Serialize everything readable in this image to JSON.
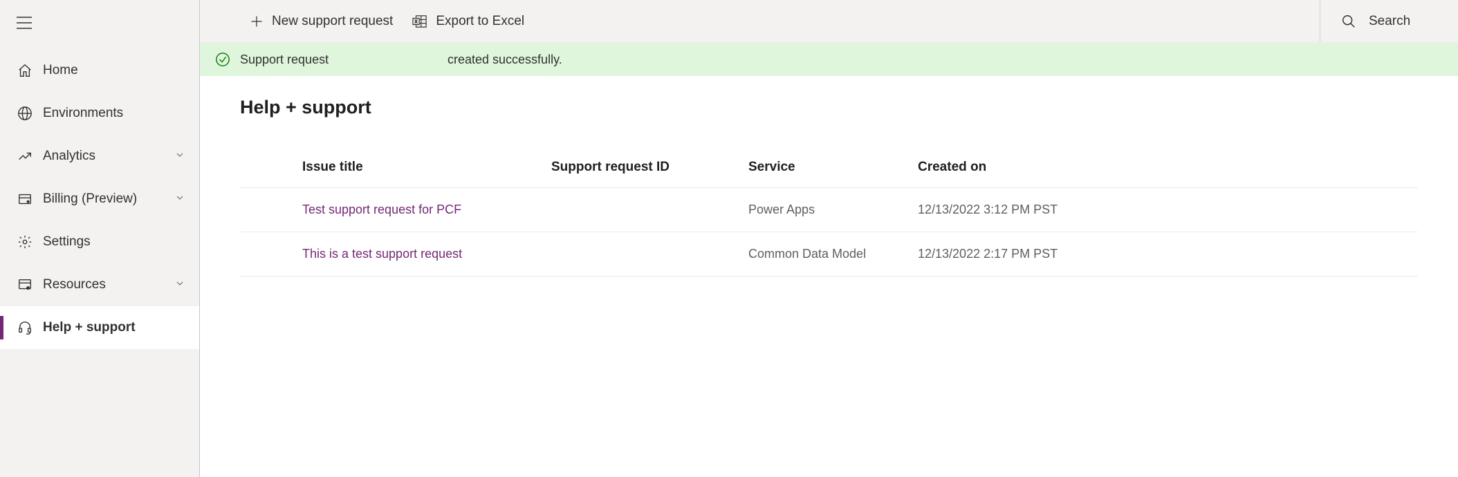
{
  "sidebar": {
    "items": [
      {
        "icon": "home",
        "label": "Home",
        "expandable": false,
        "active": false
      },
      {
        "icon": "environments",
        "label": "Environments",
        "expandable": false,
        "active": false
      },
      {
        "icon": "analytics",
        "label": "Analytics",
        "expandable": true,
        "active": false
      },
      {
        "icon": "billing",
        "label": "Billing (Preview)",
        "expandable": true,
        "active": false
      },
      {
        "icon": "settings",
        "label": "Settings",
        "expandable": false,
        "active": false
      },
      {
        "icon": "resources",
        "label": "Resources",
        "expandable": true,
        "active": false
      },
      {
        "icon": "help",
        "label": "Help + support",
        "expandable": false,
        "active": true
      }
    ]
  },
  "toolbar": {
    "new_request_label": "New support request",
    "export_label": "Export to Excel",
    "search_label": "Search"
  },
  "notification": {
    "label": "Support request",
    "message": "created successfully."
  },
  "page": {
    "title": "Help + support"
  },
  "table": {
    "columns": {
      "issue_title": "Issue title",
      "request_id": "Support request ID",
      "service": "Service",
      "created_on": "Created on"
    },
    "rows": [
      {
        "issue_title": "Test support request for PCF",
        "request_id": "",
        "service": "Power Apps",
        "created_on": "12/13/2022 3:12 PM PST"
      },
      {
        "issue_title": "This is a test support request",
        "request_id": "",
        "service": "Common Data Model",
        "created_on": "12/13/2022 2:17 PM PST"
      }
    ]
  }
}
